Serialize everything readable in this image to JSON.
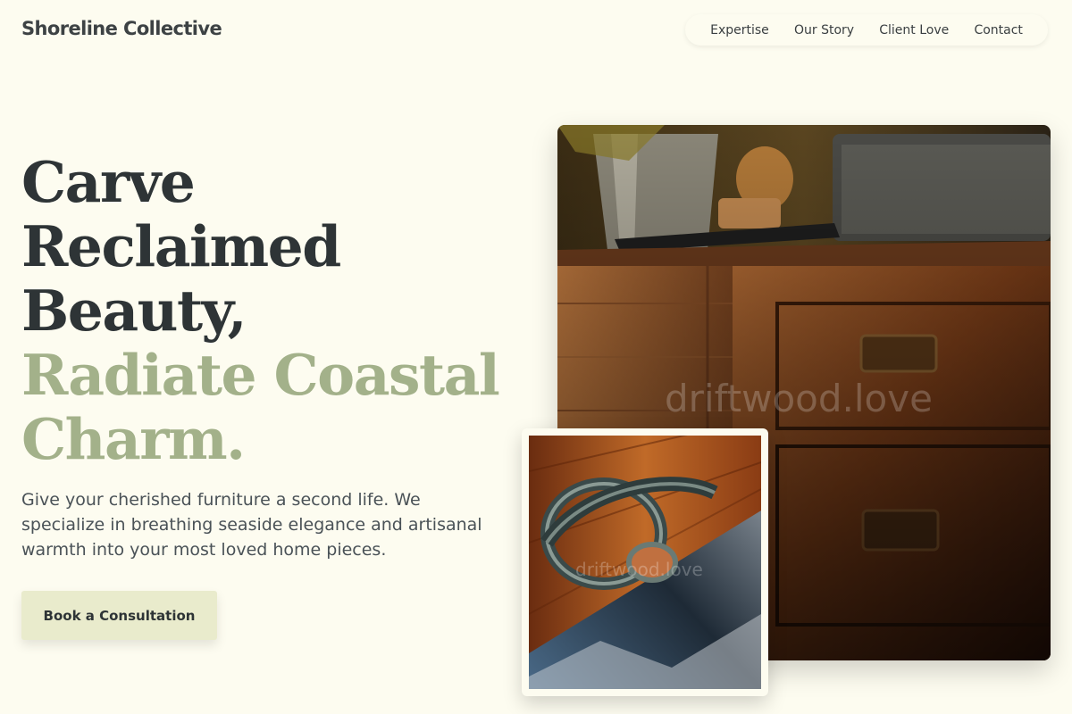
{
  "brand": {
    "name": "Shoreline Collective"
  },
  "nav": {
    "items": [
      {
        "label": "Expertise"
      },
      {
        "label": "Our Story"
      },
      {
        "label": "Client Love"
      },
      {
        "label": "Contact"
      }
    ]
  },
  "hero": {
    "headline_lines": [
      "Carve",
      "Reclaimed",
      "Beauty,"
    ],
    "accent_lines": [
      "Radiate Coastal",
      "Charm."
    ],
    "description": "Give your cherished furniture a second life. We specialize in breathing seaside elegance and artisanal warmth into your most loved home pieces.",
    "cta_label": "Book a Consultation"
  },
  "images": {
    "main_watermark": "driftwood.love",
    "inset_watermark": "driftwood.love"
  },
  "colors": {
    "background": "#fdfcf0",
    "text": "#2e3436",
    "accent": "#a3b18a",
    "cta_bg": "#e9ebcc"
  }
}
